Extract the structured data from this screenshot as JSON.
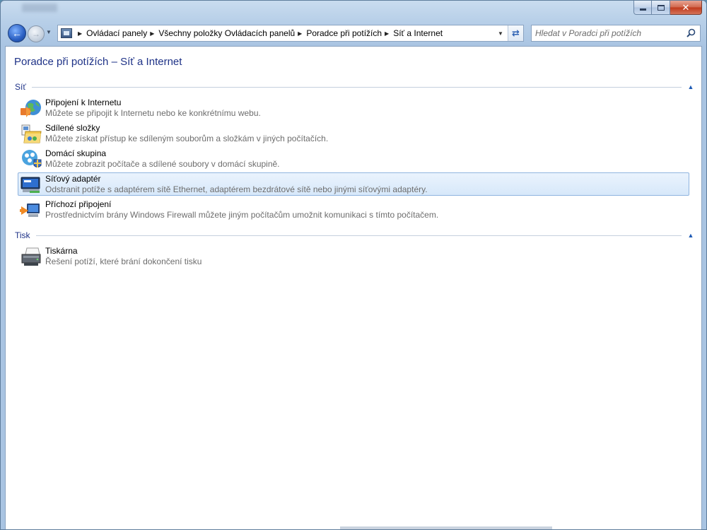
{
  "window": {
    "caption_minimize": "–",
    "caption_maximize": "□",
    "caption_close": "✕"
  },
  "nav": {
    "back_icon": "arrow-left-icon",
    "forward_icon": "arrow-right-icon",
    "history_icon": "chevron-down-icon",
    "breadcrumbs": [
      "Ovládací panely",
      "Všechny položky Ovládacích panelů",
      "Poradce při potížích",
      "Síť a Internet"
    ],
    "refresh_icon": "refresh-icon",
    "search_placeholder": "Hledat v Poradci při potížích"
  },
  "page": {
    "title": "Poradce při potížích – Síť a Internet"
  },
  "groups": [
    {
      "name": "Síť",
      "items": [
        {
          "title": "Připojení k Internetu",
          "desc": "Můžete se připojit k Internetu nebo ke konkrétnímu webu.",
          "icon": "globe-connection-icon"
        },
        {
          "title": "Sdílené složky",
          "desc": "Můžete získat přístup ke sdíleným souborům a složkám v jiných počítačích.",
          "icon": "shared-folder-icon"
        },
        {
          "title": "Domácí skupina",
          "desc": "Můžete zobrazit počítače a sdílené soubory v domácí skupině.",
          "icon": "homegroup-icon"
        },
        {
          "title": "Síťový adaptér",
          "desc": "Odstranit potíže s adaptérem sítě Ethernet, adaptérem bezdrátové sítě nebo jinými síťovými adaptéry.",
          "icon": "network-adapter-icon",
          "selected": true
        },
        {
          "title": "Příchozí připojení",
          "desc": "Prostřednictvím brány Windows Firewall můžete jiným počítačům umožnit komunikaci s tímto počítačem.",
          "icon": "incoming-connection-icon"
        }
      ]
    },
    {
      "name": "Tisk",
      "items": [
        {
          "title": "Tiskárna",
          "desc": "Řešení potíží, které brání dokončení tisku",
          "icon": "printer-icon"
        }
      ]
    }
  ]
}
